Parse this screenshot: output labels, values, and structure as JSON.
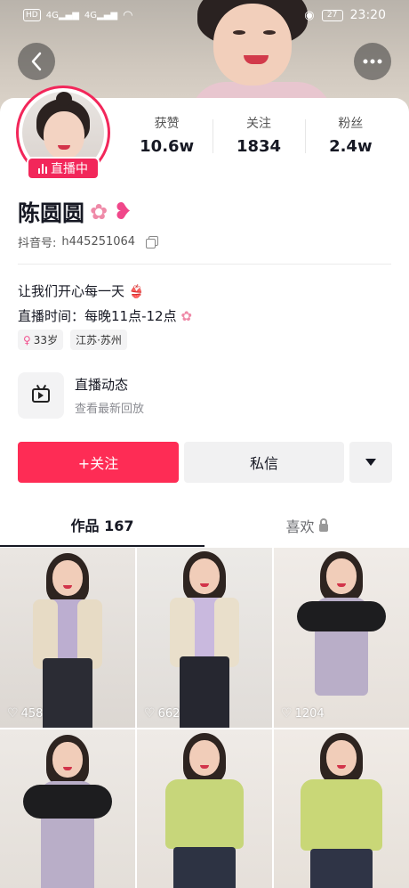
{
  "status_bar": {
    "left_chips": [
      "HD",
      "4G",
      "4G"
    ],
    "battery": "27",
    "time": "23:20"
  },
  "profile": {
    "live_badge": "直播中",
    "stats": [
      {
        "label": "获赞",
        "value": "10.6w"
      },
      {
        "label": "关注",
        "value": "1834"
      },
      {
        "label": "粉丝",
        "value": "2.4w"
      }
    ],
    "name": "陈圆圆",
    "id_label": "抖音号:",
    "id_value": "h445251064",
    "bio_line1": "让我们开心每一天",
    "bio_line2": "直播时间：每晚11点-12点",
    "tags": [
      {
        "icon": "female-icon",
        "text": "33岁"
      },
      {
        "icon": "",
        "text": "江苏·苏州"
      }
    ],
    "live_entry": {
      "title": "直播动态",
      "subtitle": "查看最新回放"
    }
  },
  "actions": {
    "follow": "+关注",
    "message": "私信"
  },
  "tabs": {
    "works": "作品 167",
    "likes": "喜欢"
  },
  "videos": [
    {
      "likes": "458"
    },
    {
      "likes": "662"
    },
    {
      "likes": "1204"
    },
    {
      "likes": ""
    },
    {
      "likes": ""
    },
    {
      "likes": ""
    }
  ],
  "colors": {
    "accent": "#fe2c55",
    "live_pink": "#f2275a",
    "text": "#161823",
    "muted": "#8a8b91"
  }
}
